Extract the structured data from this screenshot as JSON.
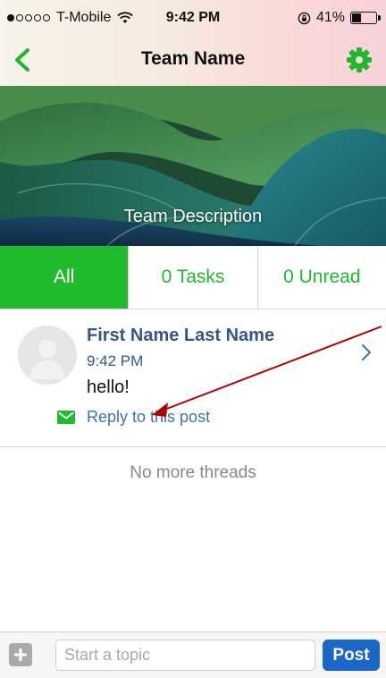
{
  "status_bar": {
    "carrier": "T-Mobile",
    "signal_strength": 1,
    "signal_total": 5,
    "time": "9:42 PM",
    "battery_label": "41%",
    "battery_level": 0.41,
    "icons": [
      "signal-dots-icon",
      "wifi-icon",
      "rotation-lock-icon",
      "battery-icon"
    ]
  },
  "nav": {
    "back_icon": "chevron-left-icon",
    "title": "Team Name",
    "settings_icon": "gear-icon"
  },
  "banner": {
    "description": "Team Description"
  },
  "tabs": [
    {
      "label": "All",
      "active": true
    },
    {
      "label": "0 Tasks",
      "active": false
    },
    {
      "label": "0 Unread",
      "active": false
    }
  ],
  "thread": {
    "author": "First Name Last Name",
    "time": "9:42 PM",
    "message": "hello!",
    "reply_label": "Reply to this post",
    "reply_icon": "envelope-icon",
    "open_icon": "chevron-right-icon",
    "avatar_icon": "default-avatar-icon"
  },
  "empty_state": {
    "text": "No more threads"
  },
  "composer": {
    "add_icon": "plus-icon",
    "placeholder": "Start a topic",
    "value": "",
    "submit_label": "Post"
  },
  "colors": {
    "accent_green": "#1fbb2d",
    "link_blue": "#3a73b3",
    "author_blue": "#34568a",
    "post_button_blue": "#1b66c9",
    "annotation_red": "#b00000"
  }
}
